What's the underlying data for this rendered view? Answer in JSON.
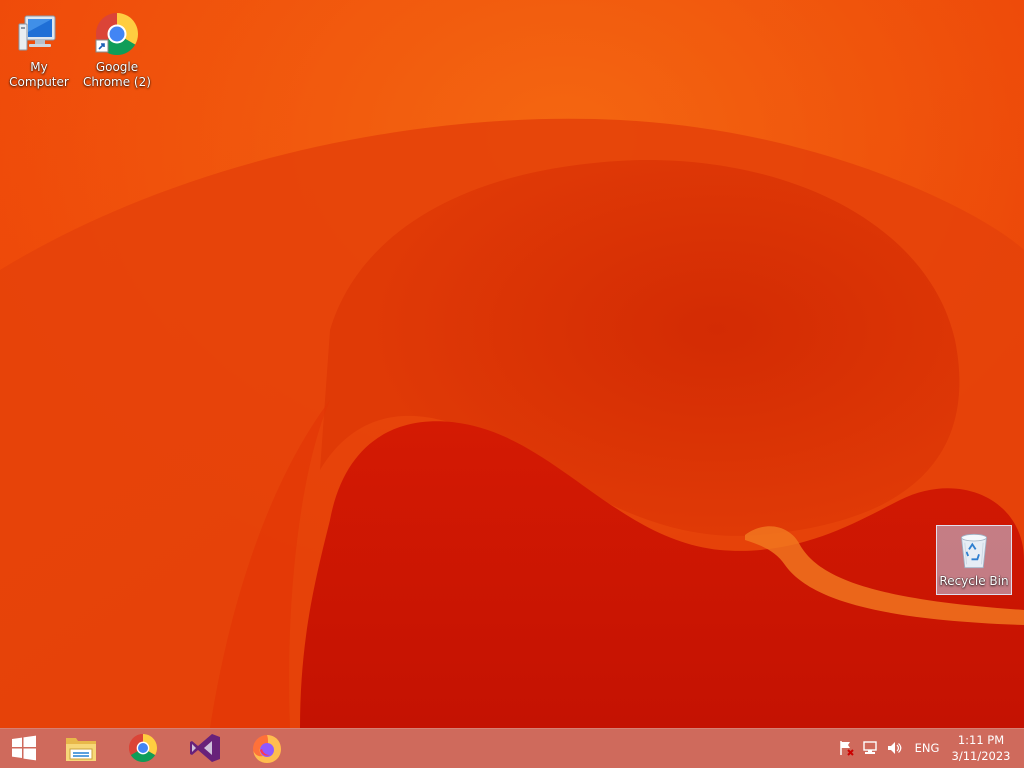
{
  "desktop": {
    "icons": [
      {
        "label": "My Computer",
        "icon": "computer-icon"
      },
      {
        "label": "Google Chrome (2)",
        "icon": "chrome-icon"
      },
      {
        "label": "Recycle Bin",
        "icon": "recycle-bin-icon",
        "selected": true
      }
    ]
  },
  "taskbar": {
    "start_icon": "windows-start-icon",
    "pinned": [
      {
        "name": "File Explorer",
        "icon": "file-explorer-icon"
      },
      {
        "name": "Google Chrome",
        "icon": "chrome-icon"
      },
      {
        "name": "Visual Studio",
        "icon": "visual-studio-icon"
      },
      {
        "name": "Firefox",
        "icon": "firefox-icon"
      }
    ],
    "tray": {
      "icons": [
        "action-center-flag-icon",
        "network-icon",
        "volume-icon"
      ],
      "language": "ENG",
      "time": "1:11 PM",
      "date": "3/11/2023"
    }
  },
  "colors": {
    "wallpaper_base": "#e8420a",
    "wallpaper_dark": "#c81e05",
    "taskbar": "#cf6a5c"
  }
}
